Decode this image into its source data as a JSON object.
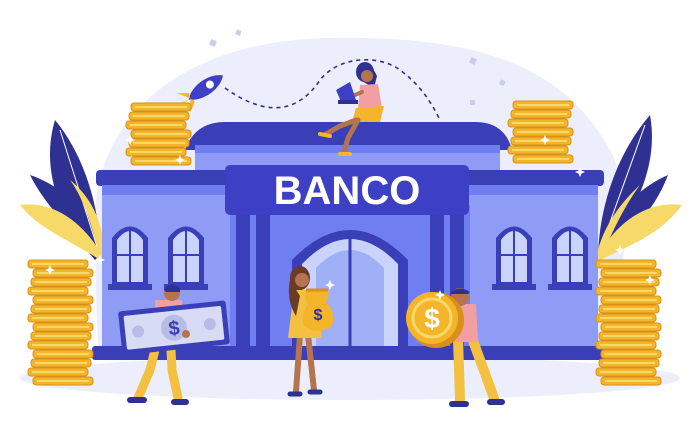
{
  "sign": {
    "text": "BANCO"
  },
  "banknote": {
    "symbol": "$"
  },
  "money_bag": {
    "symbol": "$"
  },
  "big_coin": {
    "symbol": "$"
  },
  "colors": {
    "building_light": "#8f9cf5",
    "building_mid": "#6f7ef0",
    "building_dark": "#3a3fb8",
    "sign_bg": "#3d40c4",
    "window_glass": "#c9d3fb",
    "coin_gold": "#f4b52a",
    "coin_shade": "#d8901a",
    "leaf_navy": "#2e3192",
    "leaf_yellow": "#f7d96a",
    "background_blob": "#eceefb",
    "skin": "#b5744e"
  },
  "icons": [
    "rocket-icon",
    "dollar-banknote-icon",
    "money-bag-icon",
    "dollar-coin-icon",
    "sparkle-icon"
  ]
}
